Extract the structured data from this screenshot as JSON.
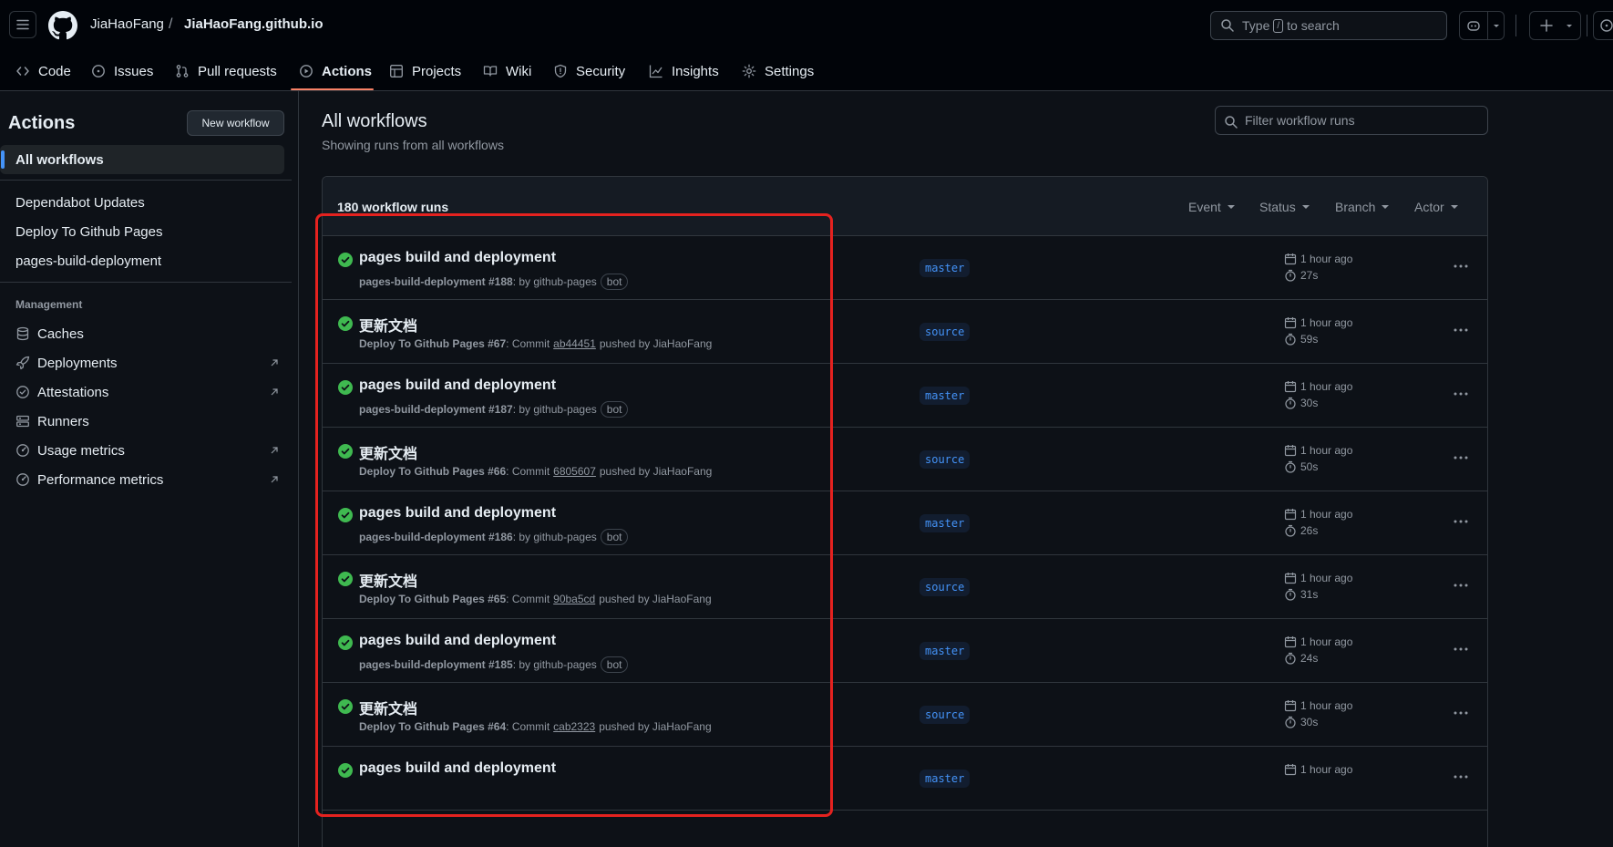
{
  "header": {
    "owner": "JiaHaoFang",
    "separator": "/",
    "repo": "JiaHaoFang.github.io",
    "search_prefix": "Type",
    "search_key": "/",
    "search_suffix": "to search"
  },
  "nav": {
    "items": [
      "Code",
      "Issues",
      "Pull requests",
      "Actions",
      "Projects",
      "Wiki",
      "Security",
      "Insights",
      "Settings"
    ],
    "active": "Actions"
  },
  "sidebar": {
    "title": "Actions",
    "new_workflow": "New workflow",
    "all_workflows": "All workflows",
    "workflows": [
      "Dependabot Updates",
      "Deploy To Github Pages",
      "pages-build-deployment"
    ],
    "management_heading": "Management",
    "management": [
      "Caches",
      "Deployments",
      "Attestations",
      "Runners",
      "Usage metrics",
      "Performance metrics"
    ]
  },
  "main": {
    "title": "All workflows",
    "subtitle": "Showing runs from all workflows",
    "filter_placeholder": "Filter workflow runs",
    "runs_count": "180 workflow runs",
    "filters": [
      "Event",
      "Status",
      "Branch",
      "Actor"
    ]
  },
  "runs": [
    {
      "title": "pages build and deployment",
      "workflow": "pages-build-deployment #188",
      "by": ": by github-pages",
      "commit": "",
      "pushed": "",
      "bot": "bot",
      "branch": "master",
      "when": "1 hour ago",
      "duration": "27s"
    },
    {
      "title": "更新文档",
      "workflow": "Deploy To Github Pages #67",
      "by": ": Commit",
      "commit": "ab44451",
      "pushed": "pushed by JiaHaoFang",
      "bot": "",
      "branch": "source",
      "when": "1 hour ago",
      "duration": "59s"
    },
    {
      "title": "pages build and deployment",
      "workflow": "pages-build-deployment #187",
      "by": ": by github-pages",
      "commit": "",
      "pushed": "",
      "bot": "bot",
      "branch": "master",
      "when": "1 hour ago",
      "duration": "30s"
    },
    {
      "title": "更新文档",
      "workflow": "Deploy To Github Pages #66",
      "by": ": Commit",
      "commit": "6805607",
      "pushed": "pushed by JiaHaoFang",
      "bot": "",
      "branch": "source",
      "when": "1 hour ago",
      "duration": "50s"
    },
    {
      "title": "pages build and deployment",
      "workflow": "pages-build-deployment #186",
      "by": ": by github-pages",
      "commit": "",
      "pushed": "",
      "bot": "bot",
      "branch": "master",
      "when": "1 hour ago",
      "duration": "26s"
    },
    {
      "title": "更新文档",
      "workflow": "Deploy To Github Pages #65",
      "by": ": Commit",
      "commit": "90ba5cd",
      "pushed": "pushed by JiaHaoFang",
      "bot": "",
      "branch": "source",
      "when": "1 hour ago",
      "duration": "31s"
    },
    {
      "title": "pages build and deployment",
      "workflow": "pages-build-deployment #185",
      "by": ": by github-pages",
      "commit": "",
      "pushed": "",
      "bot": "bot",
      "branch": "master",
      "when": "1 hour ago",
      "duration": "24s"
    },
    {
      "title": "更新文档",
      "workflow": "Deploy To Github Pages #64",
      "by": ": Commit",
      "commit": "cab2323",
      "pushed": "pushed by JiaHaoFang",
      "bot": "",
      "branch": "source",
      "when": "1 hour ago",
      "duration": "30s"
    },
    {
      "title": "pages build and deployment",
      "workflow": "",
      "by": "",
      "commit": "",
      "pushed": "",
      "bot": "",
      "branch": "master",
      "when": "1 hour ago",
      "duration": ""
    }
  ],
  "colors": {
    "success": "#3fb950",
    "annotation": "#e5221f",
    "accent": "#4493f8",
    "active_tab": "#f78166"
  }
}
